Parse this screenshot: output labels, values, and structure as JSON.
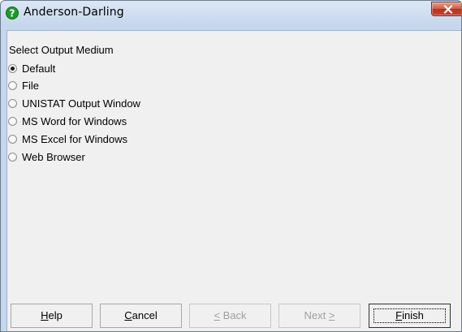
{
  "window": {
    "title": "Anderson-Darling"
  },
  "output": {
    "section_label": "Select Output Medium",
    "selected_index": 0,
    "options": [
      {
        "label": "Default"
      },
      {
        "label": "File"
      },
      {
        "label": "UNISTAT Output Window"
      },
      {
        "label": "MS Word for Windows"
      },
      {
        "label": "MS Excel for Windows"
      },
      {
        "label": "Web Browser"
      }
    ]
  },
  "buttons": {
    "help": {
      "mnemonic": "H",
      "rest": "elp"
    },
    "cancel": {
      "mnemonic": "C",
      "rest": "ancel"
    },
    "back": {
      "mnemonic": "<",
      "rest": " Back"
    },
    "next": {
      "text": "Next ",
      "mnemonic": ">"
    },
    "finish": {
      "mnemonic": "F",
      "rest": "inish"
    }
  },
  "icons": {
    "title": "help-question-icon",
    "close": "close-icon"
  },
  "colors": {
    "title_icon": "#1e9a2c",
    "close_button": "#c74330",
    "client_bg": "#f0f0f0"
  }
}
